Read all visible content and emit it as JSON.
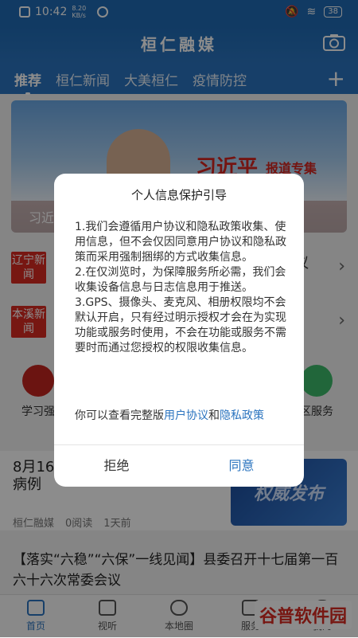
{
  "status_bar": {
    "time": "10:42",
    "net_speed": "8.20 KB/s",
    "battery": "38"
  },
  "header": {
    "app_name": "桓仁融媒"
  },
  "tabs": [
    "推荐",
    "桓仁新闻",
    "大美桓仁",
    "疫情防控"
  ],
  "banner": {
    "title": "习近平",
    "subtitle": "报道专集",
    "caption": "习近"
  },
  "list_rows": [
    {
      "tag": "辽宁新闻",
      "text": "议"
    },
    {
      "tag": "本溪新闻",
      "text": ""
    }
  ],
  "quick_icons": [
    {
      "label": "学习强"
    },
    {
      "label": "区服务"
    }
  ],
  "news_item": {
    "title_line1": "8月16",
    "title_line2": "病例",
    "source": "桓仁融媒",
    "reads": "0阅读",
    "time": "1天前",
    "thumb_text": "权威发布"
  },
  "headline": "【落实“六稳”“六保”一线见闻】县委召开十七届第一百六十六次常委会议",
  "bottom_nav": [
    "首页",
    "视听",
    "本地圈",
    "服务",
    "我的"
  ],
  "watermark": "谷普软件园",
  "dialog": {
    "title": "个人信息保护引导",
    "p1": "1.我们会遵循用户协议和隐私政策收集、使用信息，但不会仅因同意用户协议和隐私政策而采用强制捆绑的方式收集信息。",
    "p2": "2.在仅浏览时，为保障服务所必需，我们会收集设备信息与日志信息用于推送。",
    "p3": "3.GPS、摄像头、麦克风、相册权限均不会默认开启，只有经过明示授权才会在为实现功能或服务时使用，不会在功能或服务不需要时而通过您授权的权限收集信息。",
    "footer_prefix": "你可以查看完整版",
    "link_agreement": "用户协议",
    "footer_and": "和",
    "link_privacy": "隐私政策",
    "reject_label": "拒绝",
    "agree_label": "同意"
  },
  "colors": {
    "brand": "#2b74bf",
    "tag_red": "#d92a22"
  }
}
